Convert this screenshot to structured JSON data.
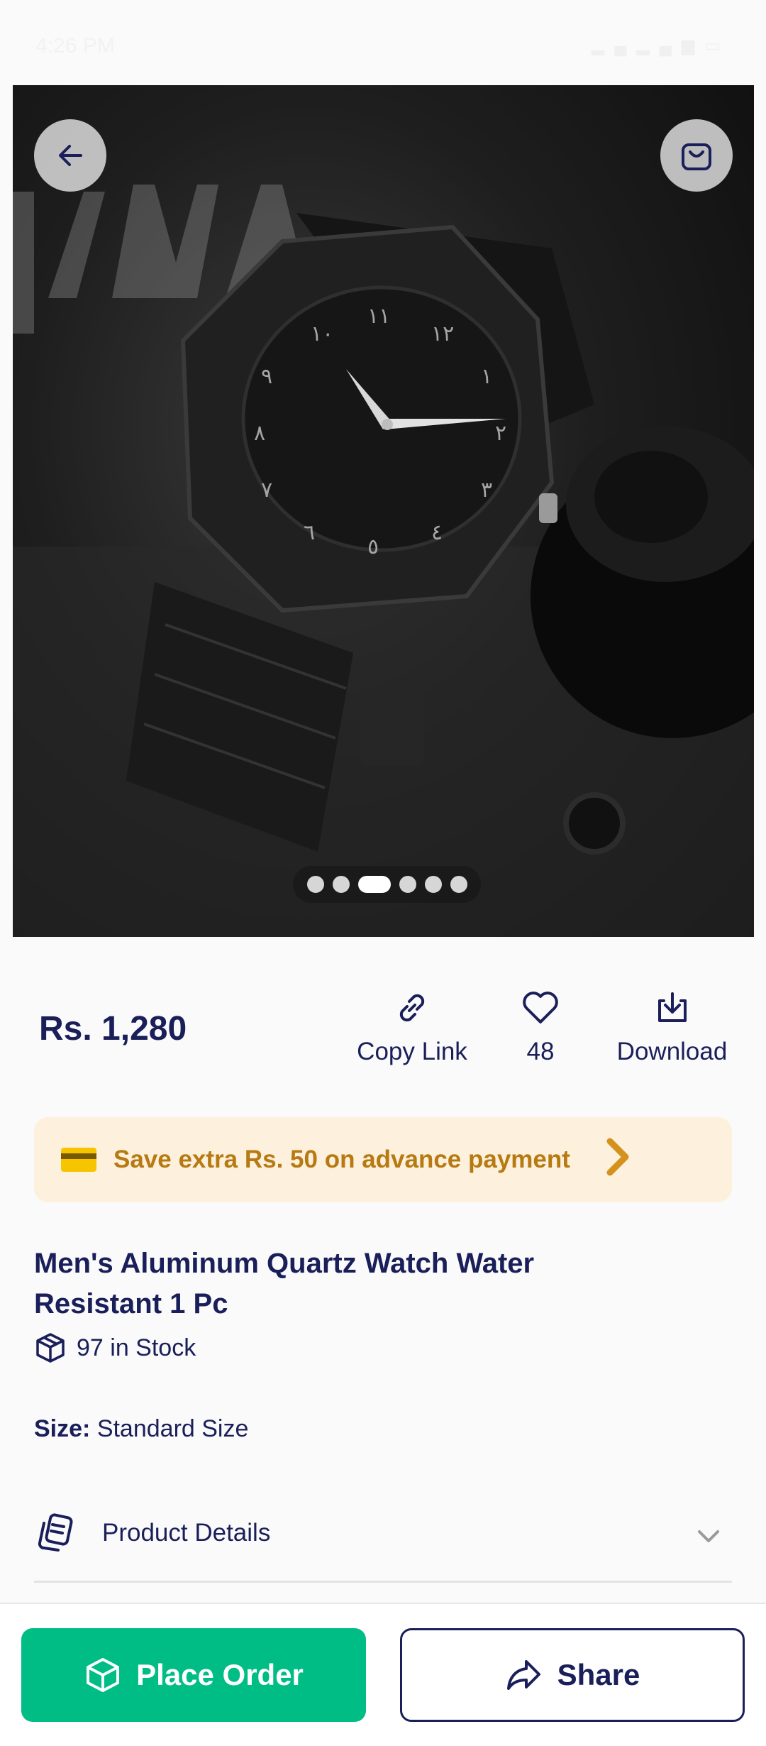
{
  "status_bar": {
    "time": "4:26 PM",
    "icons": [
      "wifi-icon",
      "signal-icon",
      "signal-icon",
      "battery-icon"
    ]
  },
  "header": {
    "back_icon": "arrow-left-icon",
    "cart_icon": "shopping-bag-icon"
  },
  "carousel": {
    "image_count": 6,
    "active_index": 2
  },
  "product": {
    "price": "Rs. 1,280",
    "title": "Men's Aluminum Quartz Watch Water Resistant 1 Pc",
    "stock": "97 in Stock",
    "size_label": "Size:",
    "size_value": "Standard Size"
  },
  "actions": {
    "copy_link": "Copy Link",
    "likes": "48",
    "download": "Download"
  },
  "promo": {
    "text": "Save extra Rs. 50 on advance payment"
  },
  "details": {
    "label": "Product Details"
  },
  "bottom": {
    "place_order": "Place Order",
    "share": "Share"
  },
  "colors": {
    "primary": "#00bd85",
    "navy": "#1a1f5a",
    "promo_bg": "#fdf0dc",
    "promo_text": "#b77a12"
  }
}
